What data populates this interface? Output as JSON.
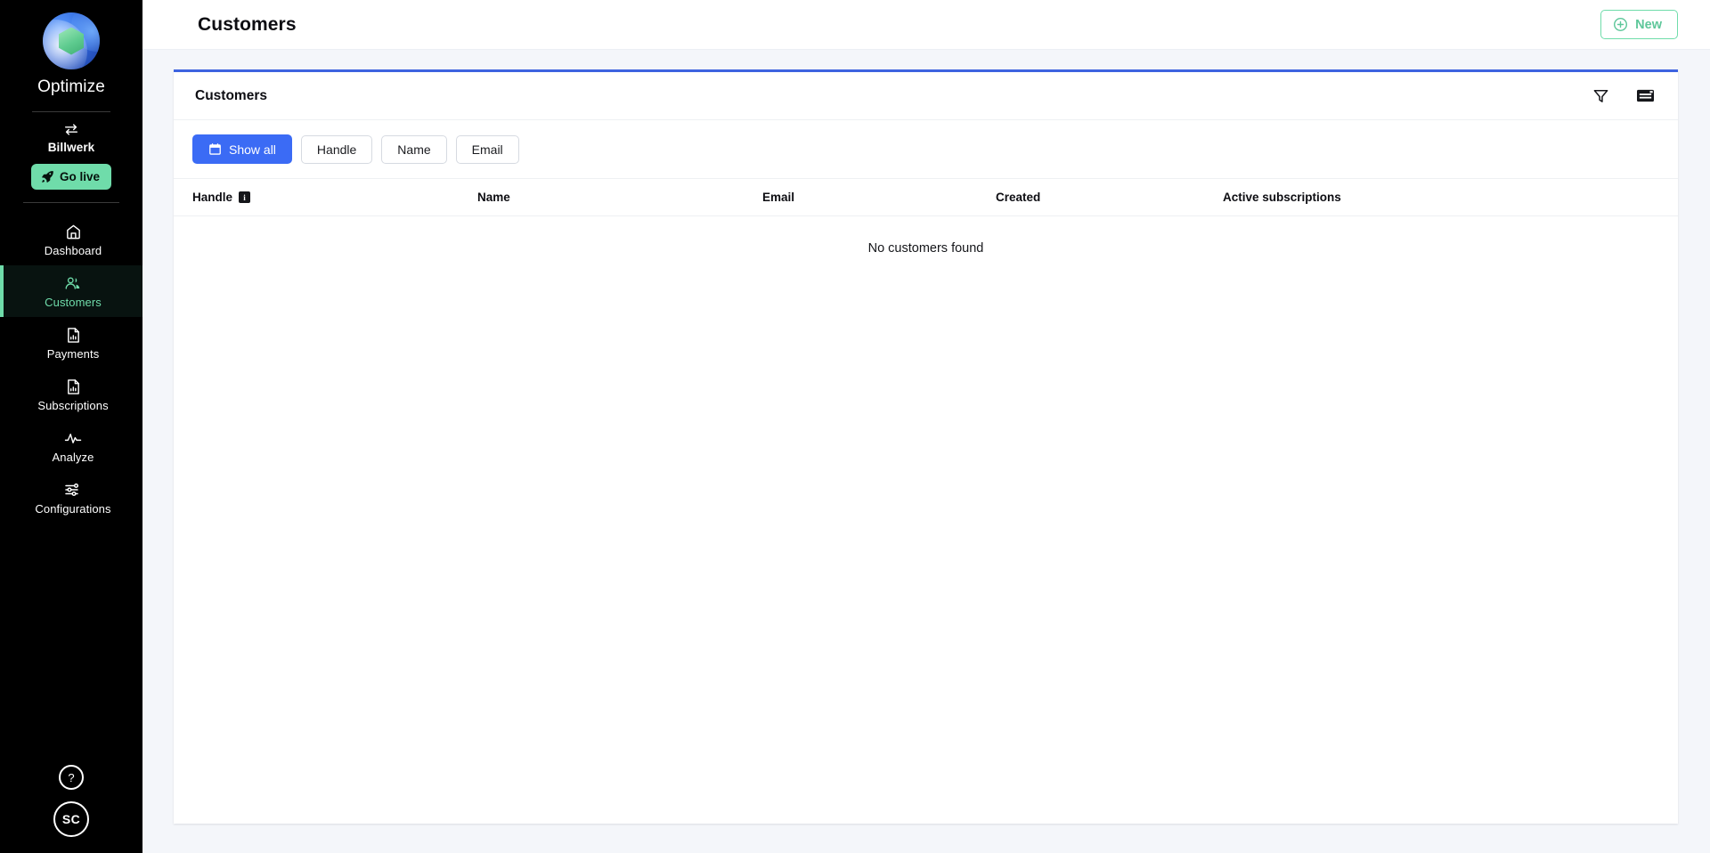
{
  "sidebar": {
    "logo_title": "Optimize",
    "org": {
      "icon": "exchange-arrows-icon",
      "name": "Billwerk"
    },
    "go_live": {
      "label": "Go live",
      "icon": "rocket-icon",
      "color": "#6fdcaa"
    },
    "nav_items": [
      {
        "label": "Dashboard",
        "icon": "home-icon",
        "active": false
      },
      {
        "label": "Customers",
        "icon": "users-icon",
        "active": true
      },
      {
        "label": "Payments",
        "icon": "file-chart-icon",
        "active": false
      },
      {
        "label": "Subscriptions",
        "icon": "file-chart-icon",
        "active": false
      },
      {
        "label": "Analyze",
        "icon": "activity-pulse-icon",
        "active": false
      },
      {
        "label": "Configurations",
        "icon": "sliders-icon",
        "active": false
      }
    ],
    "help_label": "?",
    "avatar_initials": "SC",
    "active_color": "#6fdcaa",
    "background": "#000000"
  },
  "topbar": {
    "title": "Customers",
    "new_button": {
      "label": "New",
      "icon": "plus-circle-icon",
      "color": "#6fdcaa"
    }
  },
  "card": {
    "title": "Customers",
    "accent_color": "#3d63e0",
    "actions": [
      {
        "name": "filter-icon",
        "label": "Filter"
      },
      {
        "name": "view-layout-icon",
        "label": "Layout"
      }
    ],
    "filters": [
      {
        "label": "Show all",
        "icon": "calendar-icon",
        "active": true
      },
      {
        "label": "Handle",
        "icon": "",
        "active": false
      },
      {
        "label": "Name",
        "icon": "",
        "active": false
      },
      {
        "label": "Email",
        "icon": "",
        "active": false
      }
    ],
    "active_filter_color": "#3b6bf5",
    "table": {
      "columns": [
        {
          "label": "Handle",
          "has_info": true
        },
        {
          "label": "Name",
          "has_info": false
        },
        {
          "label": "Email",
          "has_info": false
        },
        {
          "label": "Created",
          "has_info": false
        },
        {
          "label": "Active subscriptions",
          "has_info": false
        }
      ],
      "rows": [],
      "empty_message": "No customers found"
    }
  }
}
